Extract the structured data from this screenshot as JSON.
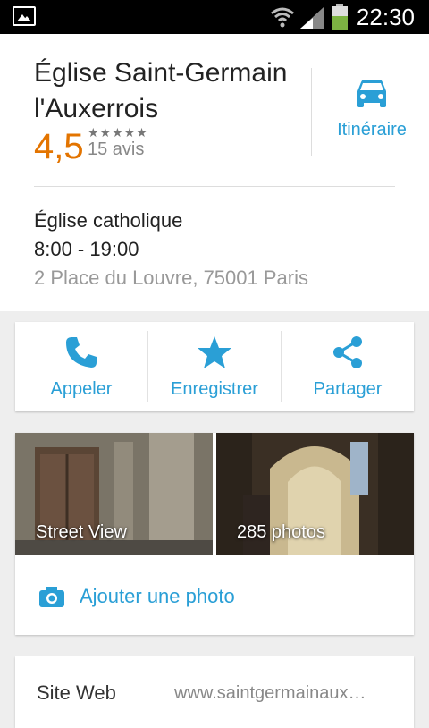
{
  "status_bar": {
    "time": "22:30",
    "icons": [
      "gallery-icon",
      "wifi-icon",
      "signal-icon",
      "battery-icon"
    ]
  },
  "place": {
    "name": "Église Saint-Germain l'Auxerrois",
    "rating": "4,5",
    "stars": "★★★★★",
    "reviews": "15 avis",
    "route_label": "Itinéraire",
    "category": "Église catholique",
    "hours": "8:00 - 19:00",
    "address": "2 Place du Louvre, 75001 Paris"
  },
  "actions": [
    {
      "label": "Appeler",
      "icon": "phone-icon"
    },
    {
      "label": "Enregistrer",
      "icon": "star-icon"
    },
    {
      "label": "Partager",
      "icon": "share-icon"
    }
  ],
  "photos": {
    "street_view_label": "Street View",
    "photos_label": "285 photos",
    "add_photo_label": "Ajouter une photo"
  },
  "website": {
    "key": "Site Web",
    "value": "www.saintgermainaux…"
  },
  "colors": {
    "accent": "#2a9fd6",
    "rating": "#e37400",
    "status_bar": "#000000"
  }
}
